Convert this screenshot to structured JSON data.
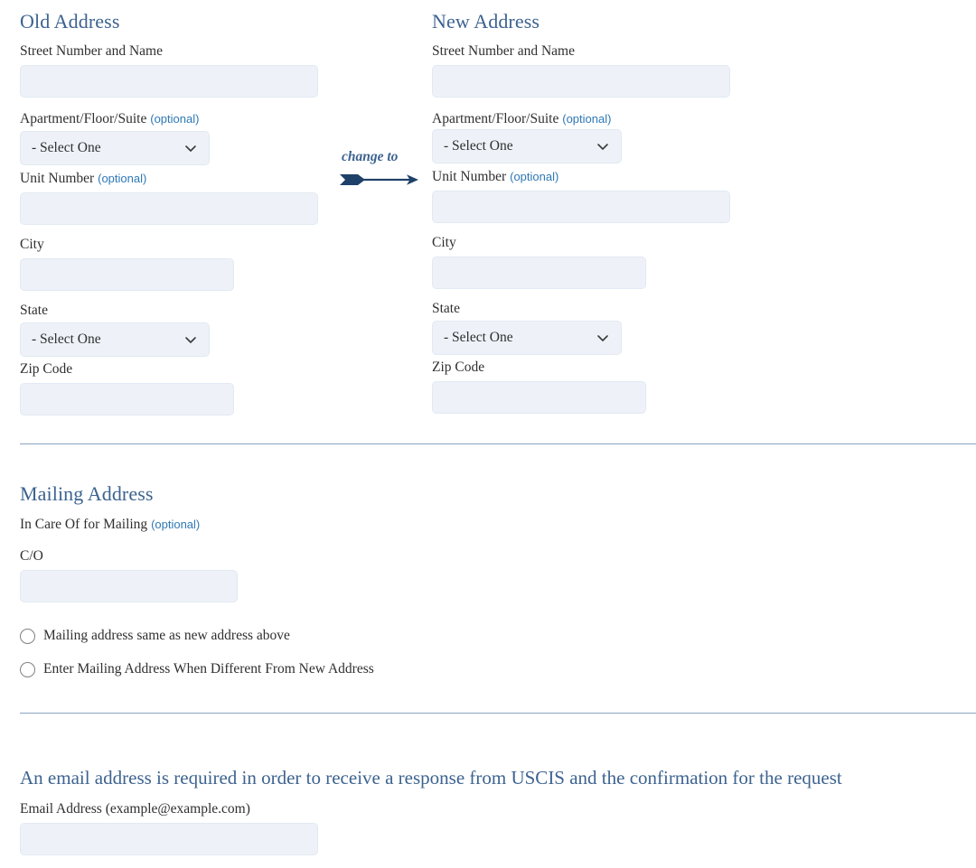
{
  "colors": {
    "heading_blue": "#3d6390",
    "optional_blue": "#2e78b5",
    "divider_blue": "#8ba4c2",
    "input_fill": "#eef2f8",
    "input_border": "#e2e9f2",
    "label_text": "#2f2f2f",
    "arrow_navy": "#1f4068",
    "radio_border": "#808080"
  },
  "old_address": {
    "heading": "Old Address",
    "street_label": "Street Number and Name",
    "street_value": "",
    "street_placeholder": "",
    "apartment_label": "Apartment/Floor/Suite",
    "apartment_optional": "(optional)",
    "apartment_selected": "- Select One",
    "unit_label": "Unit Number",
    "unit_optional": "(optional)",
    "unit_value": "",
    "city_label": "City",
    "city_value": "",
    "state_label": "State",
    "state_selected": "- Select One",
    "zip_label": "Zip Code",
    "zip_value": ""
  },
  "connector": {
    "label": "change to",
    "icon": "arrow-right-icon"
  },
  "new_address": {
    "heading": "New Address",
    "street_label": "Street Number and Name",
    "street_value": "",
    "apartment_label": "Apartment/Floor/Suite",
    "apartment_optional": "(optional)",
    "apartment_selected": "- Select One",
    "unit_label": "Unit Number",
    "unit_optional": "(optional)",
    "unit_value": "",
    "city_label": "City",
    "city_value": "",
    "state_label": "State",
    "state_selected": "- Select One",
    "zip_label": "Zip Code",
    "zip_value": ""
  },
  "mailing": {
    "heading": "Mailing Address",
    "in_care_of_label": "In Care Of for Mailing",
    "in_care_of_optional": "(optional)",
    "co_label": "C/O",
    "co_value": "",
    "radio_same_label": "Mailing address same as new address above",
    "radio_different_label": "Enter Mailing Address When Different From New Address",
    "radio_same_checked": false,
    "radio_different_checked": false
  },
  "email": {
    "heading": "An email address is required in order to receive a response from USCIS and the confirmation for the request",
    "label": "Email Address (example@example.com)",
    "value": ""
  }
}
